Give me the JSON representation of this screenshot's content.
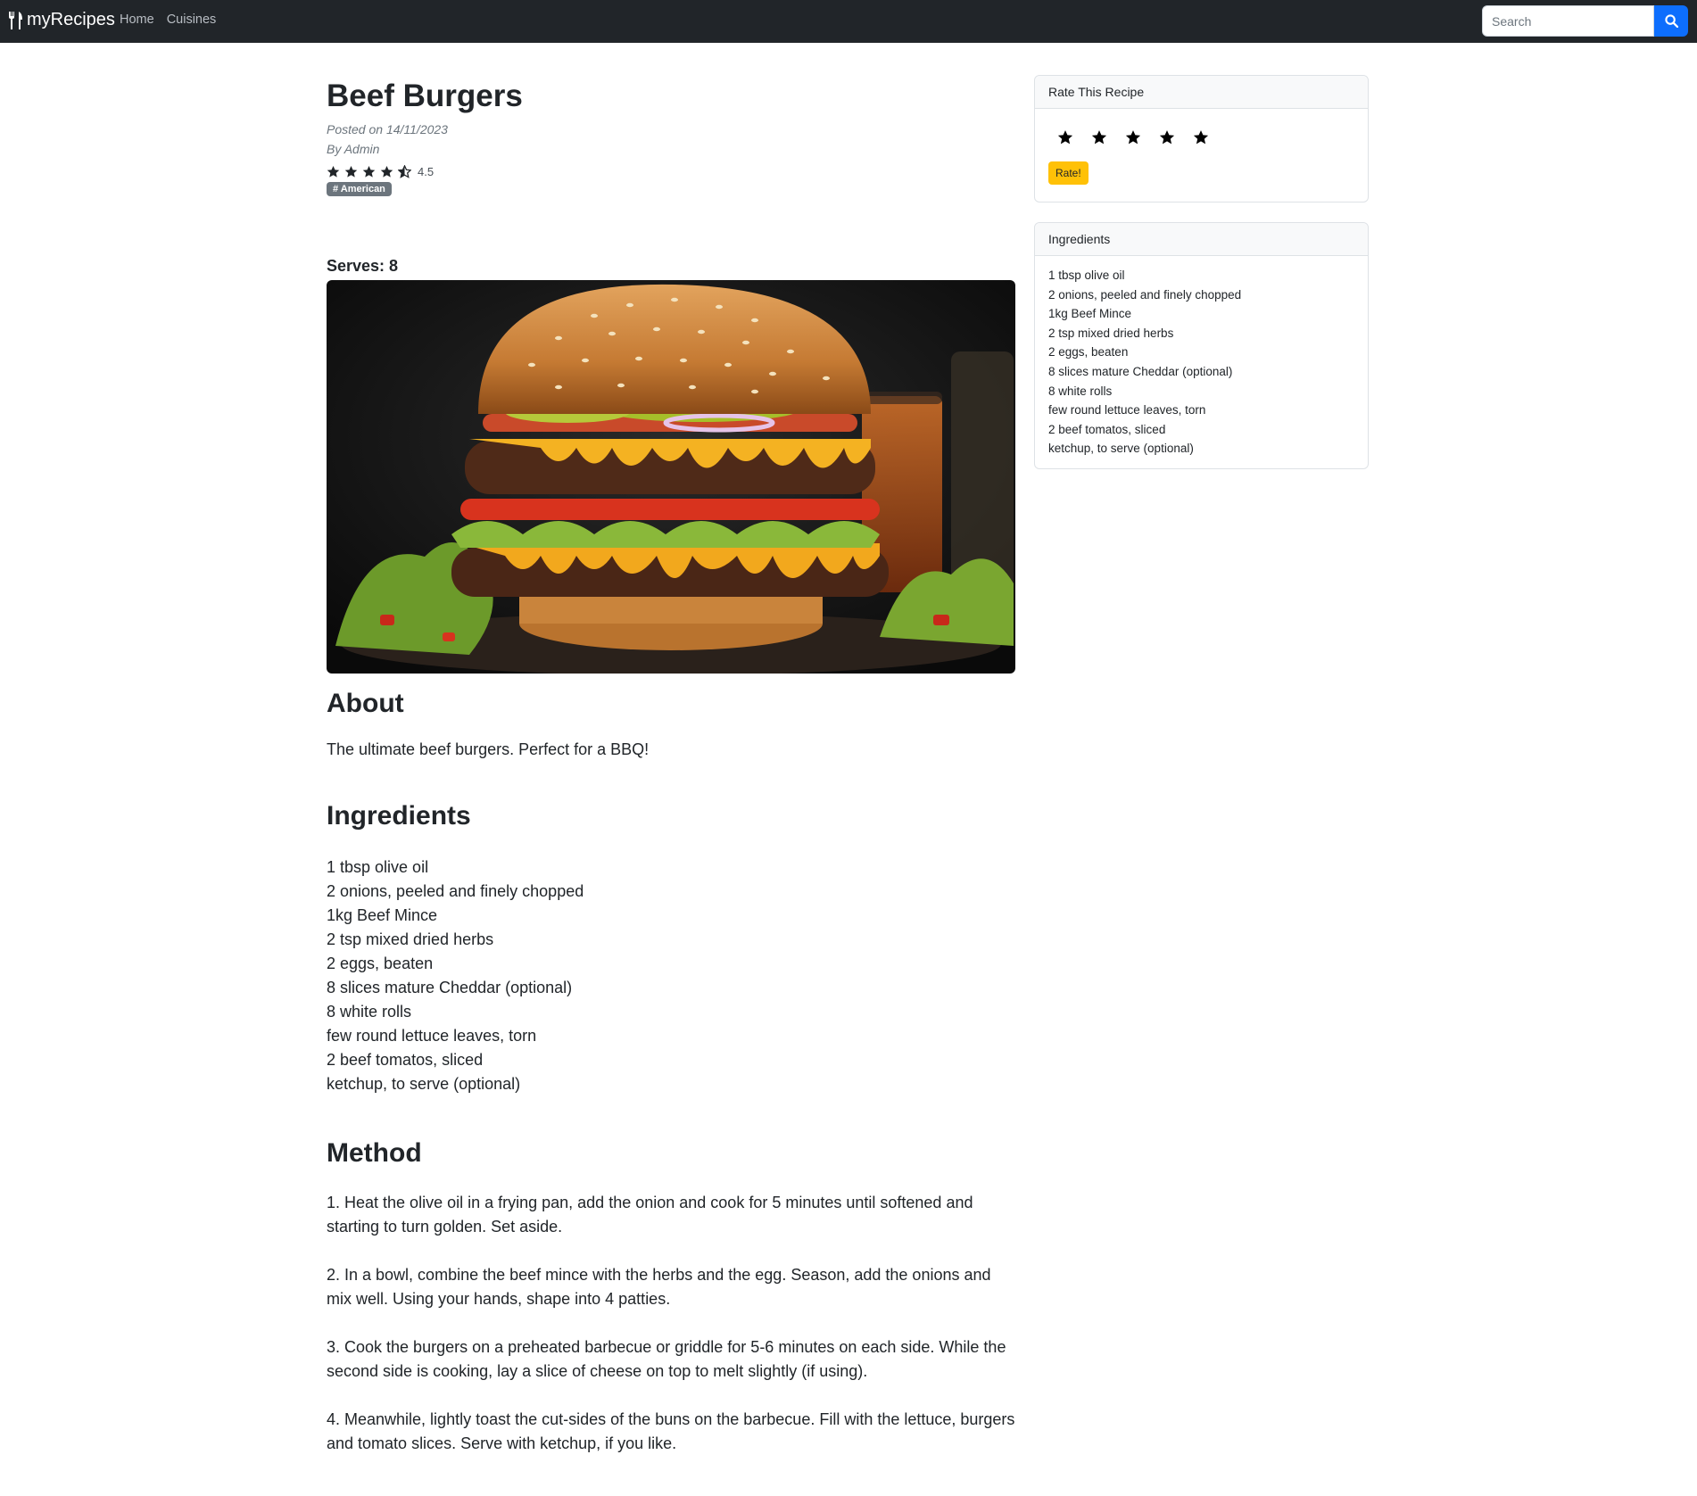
{
  "nav": {
    "brand": "myRecipes",
    "links": [
      "Home",
      "Cuisines"
    ],
    "search_placeholder": "Search"
  },
  "recipe": {
    "title": "Beef Burgers",
    "posted": "Posted on 14/11/2023",
    "author": "By Admin",
    "rating": 4.5,
    "rating_text": "4.5",
    "tag": "# American",
    "serves_label": "Serves: 8",
    "image_alt": "burger-photo",
    "about_heading": "About",
    "about_text": "The ultimate beef burgers. Perfect for a BBQ!",
    "ingredients_heading": "Ingredients",
    "ingredients": [
      "1 tbsp olive oil",
      "2 onions, peeled and finely chopped",
      "1kg Beef Mince",
      "2 tsp mixed dried herbs",
      "2 eggs, beaten",
      "8 slices mature Cheddar (optional)",
      "8 white rolls",
      "few round lettuce leaves, torn",
      "2 beef tomatos, sliced",
      "ketchup, to serve (optional)"
    ],
    "method_heading": "Method",
    "method": [
      "1. Heat the olive oil in a frying pan, add the onion and cook for 5 minutes until softened and starting to turn golden. Set aside.",
      "2. In a bowl, combine the beef mince with the herbs and the egg. Season, add the onions and mix well. Using your hands, shape into 4 patties.",
      "3. Cook the burgers on a preheated barbecue or griddle for 5-6 minutes on each side. While the second side is cooking, lay a slice of cheese on top to melt slightly (if using).",
      "4. Meanwhile, lightly toast the cut-sides of the buns on the barbecue. Fill with the lettuce, burgers and tomato slices. Serve with ketchup, if you like."
    ]
  },
  "sidebar": {
    "rate_header": "Rate This Recipe",
    "rate_stars": 5,
    "rate_button": "Rate!",
    "ingredients_header": "Ingredients"
  },
  "colors": {
    "navbar": "#212529",
    "search_button": "#0d6efd",
    "rate_button": "#ffc107",
    "badge": "#6c757d"
  }
}
